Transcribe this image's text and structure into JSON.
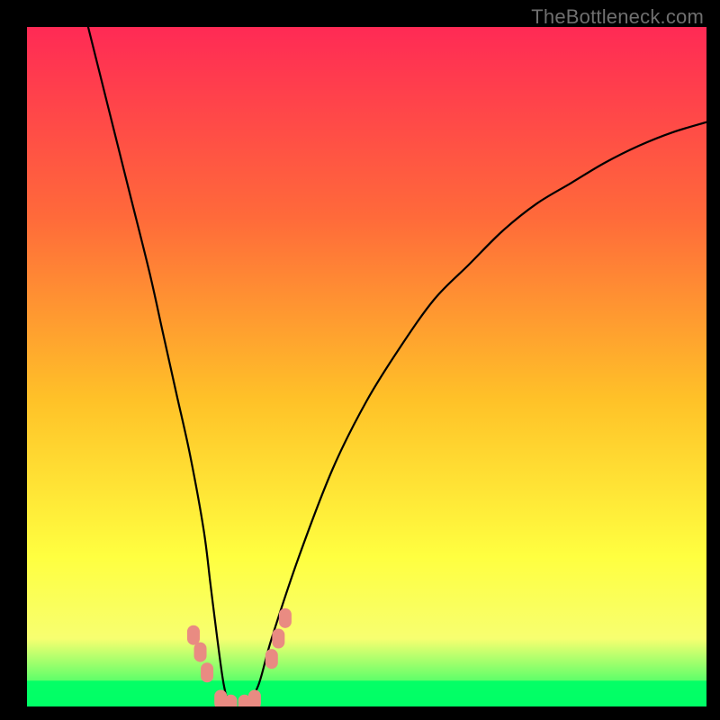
{
  "watermark": "TheBottleneck.com",
  "chart_data": {
    "type": "line",
    "title": "",
    "xlabel": "",
    "ylabel": "",
    "xlim": [
      0,
      100
    ],
    "ylim": [
      0,
      100
    ],
    "grid": false,
    "legend": false,
    "background_gradient": [
      "#ff2a55",
      "#ff6a3a",
      "#ffc228",
      "#ffff40",
      "#f7ff70",
      "#00ff66"
    ],
    "series": [
      {
        "name": "bottleneck-curve",
        "x": [
          9,
          12,
          15,
          18,
          20,
          22,
          24,
          26,
          27,
          28,
          29,
          30,
          32,
          34,
          36,
          40,
          45,
          50,
          55,
          60,
          65,
          70,
          75,
          80,
          85,
          90,
          95,
          100
        ],
        "y": [
          100,
          88,
          76,
          64,
          55,
          46,
          37,
          26,
          18,
          10,
          3,
          0,
          0,
          3,
          10,
          22,
          35,
          45,
          53,
          60,
          65,
          70,
          74,
          77,
          80,
          82.5,
          84.5,
          86
        ]
      }
    ],
    "markers": [
      {
        "name": "left-marker-1",
        "x": 24.5,
        "y": 10.5
      },
      {
        "name": "left-marker-2",
        "x": 25.5,
        "y": 8.0
      },
      {
        "name": "left-marker-3",
        "x": 26.5,
        "y": 5.0
      },
      {
        "name": "floor-marker-1",
        "x": 28.5,
        "y": 1.0
      },
      {
        "name": "floor-marker-2",
        "x": 30.0,
        "y": 0.3
      },
      {
        "name": "floor-marker-3",
        "x": 32.0,
        "y": 0.3
      },
      {
        "name": "floor-marker-4",
        "x": 33.5,
        "y": 1.0
      },
      {
        "name": "right-marker-1",
        "x": 36.0,
        "y": 7.0
      },
      {
        "name": "right-marker-2",
        "x": 37.0,
        "y": 10.0
      },
      {
        "name": "right-marker-3",
        "x": 38.0,
        "y": 13.0
      }
    ],
    "floor_band": {
      "y0": 0,
      "y1": 3.8
    }
  }
}
